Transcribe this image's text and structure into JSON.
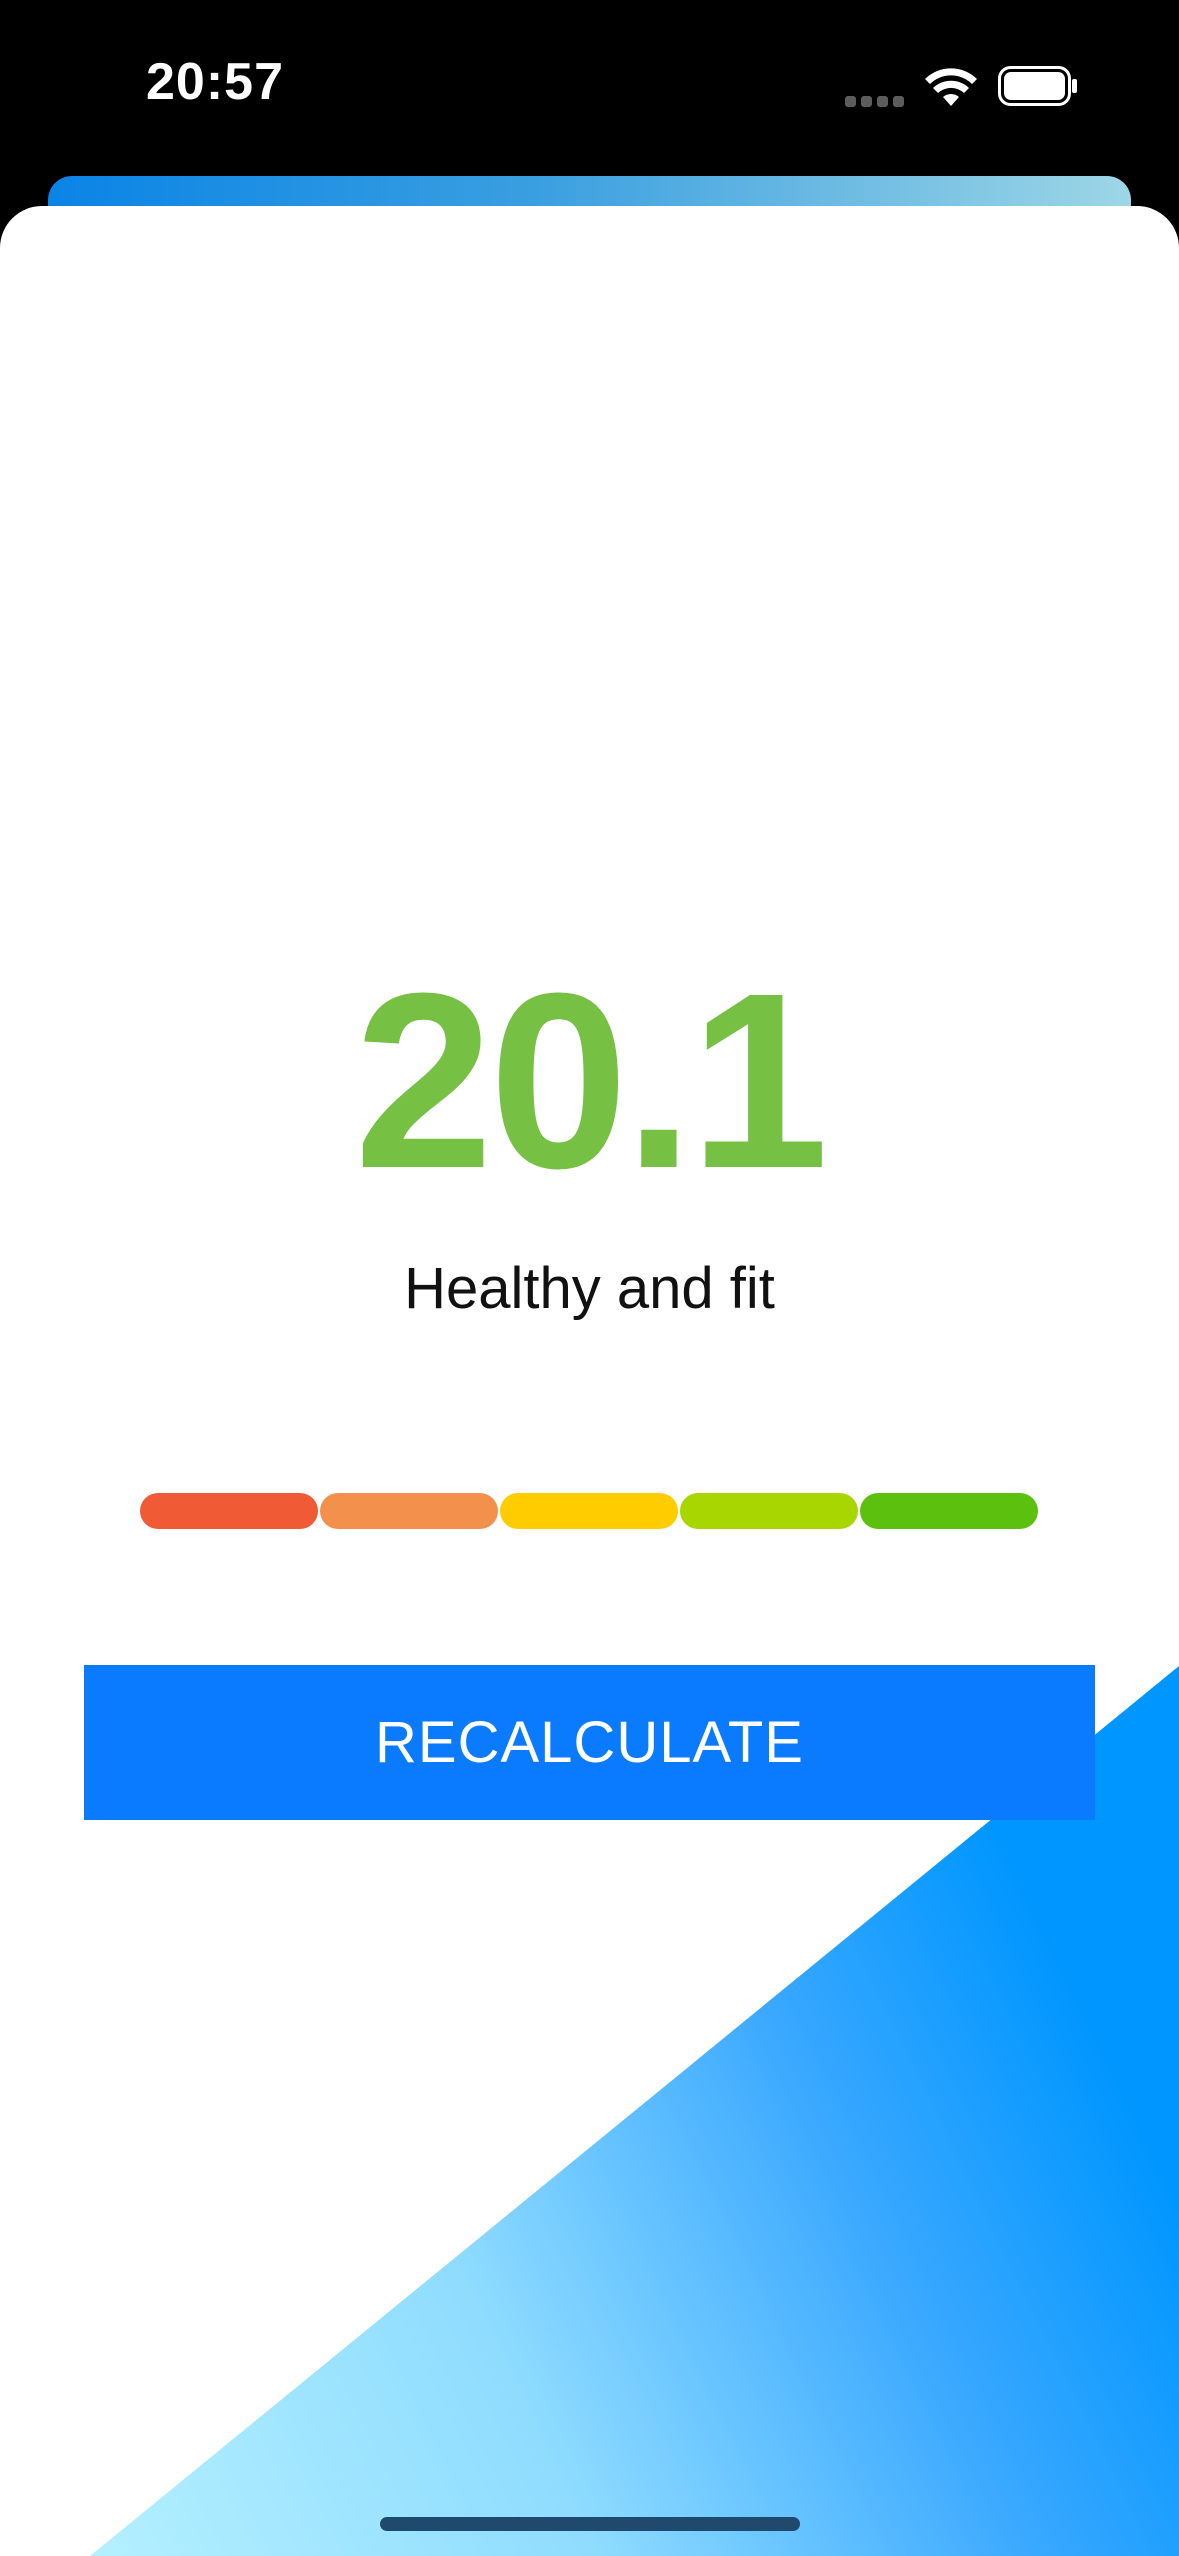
{
  "status_bar": {
    "time": "20:57"
  },
  "result": {
    "bmi_value": "20.1",
    "status_text": "Healthy and fit",
    "value_color": "#76c043"
  },
  "scale": {
    "segments": [
      {
        "color": "#f05a35"
      },
      {
        "color": "#f3904b"
      },
      {
        "color": "#ffcc00"
      },
      {
        "color": "#a8d600"
      },
      {
        "color": "#5cc10e"
      }
    ]
  },
  "actions": {
    "recalculate_label": "RECALCULATE",
    "button_color": "#0a7aff"
  },
  "icons": {
    "signal": "signal-icon",
    "wifi": "wifi-icon",
    "battery": "battery-icon"
  }
}
